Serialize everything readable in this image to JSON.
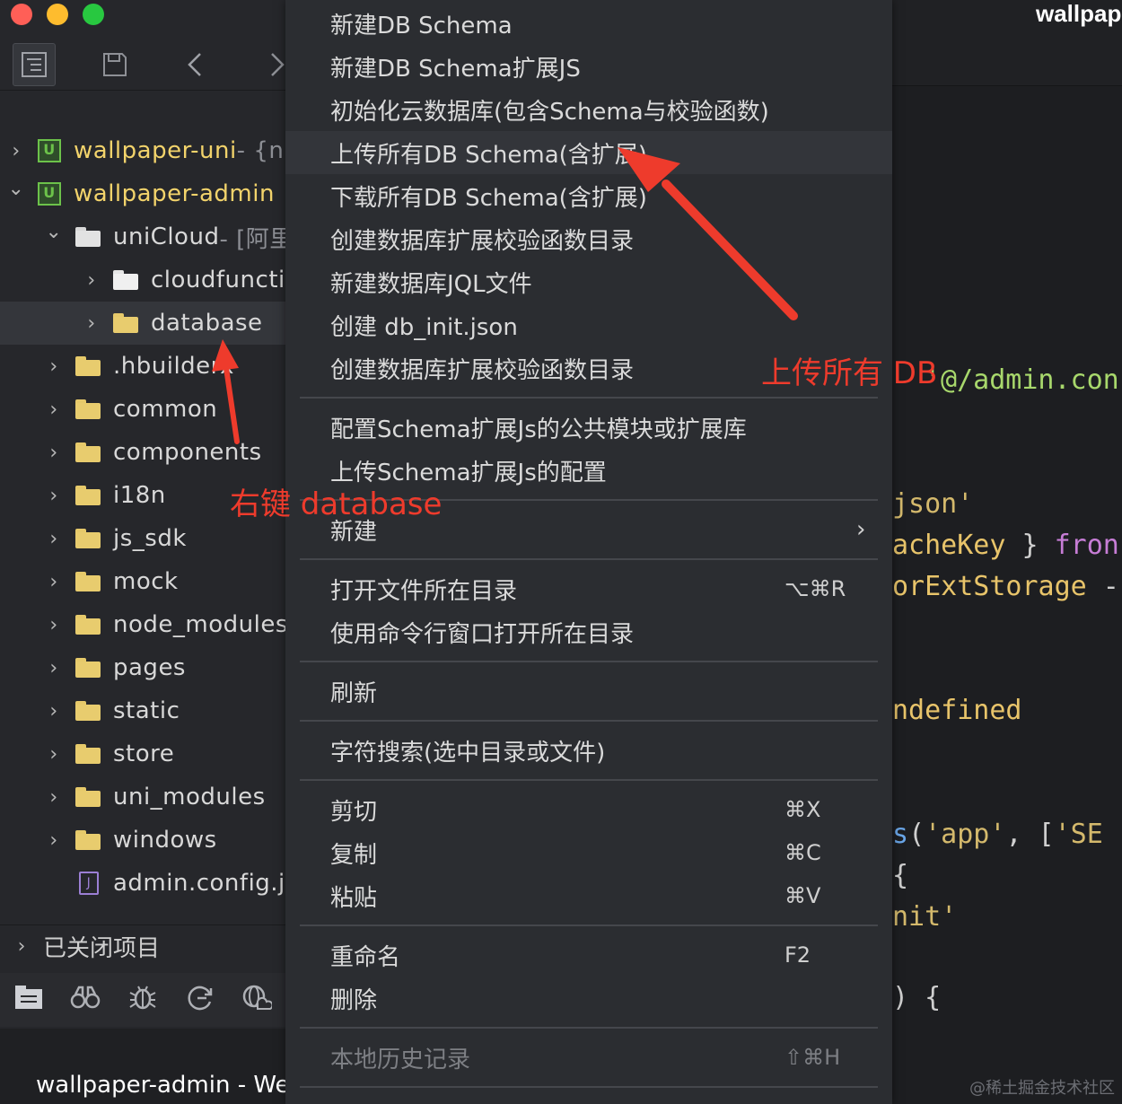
{
  "sidebar": {
    "toolbar": {
      "explorer_icon": "project-explorer-icon",
      "save_icon": "save-icon",
      "back_icon": "chevron-left-icon",
      "forward_icon": "chevron-right-icon"
    },
    "tree": [
      {
        "label": "wallpaper-uni",
        "suffix": " - {n",
        "expanded": false,
        "kind": "project"
      },
      {
        "label": "wallpaper-admin",
        "suffix": "",
        "expanded": true,
        "kind": "project"
      },
      {
        "label": "uniCloud",
        "suffix": " - [阿里",
        "expanded": true,
        "kind": "open-folder"
      },
      {
        "label": "cloudfunctio",
        "suffix": "",
        "expanded": false,
        "kind": "cloud-folder"
      },
      {
        "label": "database",
        "suffix": "",
        "expanded": false,
        "kind": "folder",
        "selected": true
      },
      {
        "label": ".hbuilderx",
        "suffix": "",
        "expanded": false,
        "kind": "folder"
      },
      {
        "label": "common",
        "suffix": "",
        "expanded": false,
        "kind": "folder"
      },
      {
        "label": "components",
        "suffix": "",
        "expanded": false,
        "kind": "folder"
      },
      {
        "label": "i18n",
        "suffix": "",
        "expanded": false,
        "kind": "folder"
      },
      {
        "label": "js_sdk",
        "suffix": "",
        "expanded": false,
        "kind": "folder"
      },
      {
        "label": "mock",
        "suffix": "",
        "expanded": false,
        "kind": "folder"
      },
      {
        "label": "node_modules",
        "suffix": "",
        "expanded": false,
        "kind": "folder"
      },
      {
        "label": "pages",
        "suffix": "",
        "expanded": false,
        "kind": "folder"
      },
      {
        "label": "static",
        "suffix": "",
        "expanded": false,
        "kind": "folder"
      },
      {
        "label": "store",
        "suffix": "",
        "expanded": false,
        "kind": "folder"
      },
      {
        "label": "uni_modules",
        "suffix": "",
        "expanded": false,
        "kind": "folder"
      },
      {
        "label": "windows",
        "suffix": "",
        "expanded": false,
        "kind": "folder"
      },
      {
        "label": "admin.config.js",
        "suffix": "",
        "expanded": false,
        "kind": "js-file"
      }
    ],
    "closed_projects": "已关闭项目",
    "bottom_tools": [
      "project-icon",
      "binoculars-icon",
      "bug-icon",
      "sync-icon",
      "cloud-globe-icon"
    ],
    "status_text": "wallpaper-admin - Web"
  },
  "menu": {
    "items": [
      {
        "label": "新建DB Schema",
        "shortcut": ""
      },
      {
        "label": "新建DB Schema扩展JS",
        "shortcut": ""
      },
      {
        "label": "初始化云数据库(包含Schema与校验函数)",
        "shortcut": ""
      },
      {
        "label": "上传所有DB Schema(含扩展)",
        "shortcut": "",
        "highlighted": true
      },
      {
        "label": "下载所有DB Schema(含扩展)",
        "shortcut": ""
      },
      {
        "label": "创建数据库扩展校验函数目录",
        "shortcut": ""
      },
      {
        "label": "新建数据库JQL文件",
        "shortcut": ""
      },
      {
        "label": "创建 db_init.json",
        "shortcut": ""
      },
      {
        "label": "创建数据库扩展校验函数目录",
        "shortcut": ""
      },
      {
        "label": "配置Schema扩展Js的公共模块或扩展库",
        "shortcut": ""
      },
      {
        "label": "上传Schema扩展Js的配置",
        "shortcut": ""
      },
      {
        "label": "新建",
        "shortcut": "",
        "submenu": true
      },
      {
        "label": "打开文件所在目录",
        "shortcut": "⌥⌘R"
      },
      {
        "label": "使用命令行窗口打开所在目录",
        "shortcut": ""
      },
      {
        "label": "刷新",
        "shortcut": ""
      },
      {
        "label": "字符搜索(选中目录或文件)",
        "shortcut": ""
      },
      {
        "label": "剪切",
        "shortcut": "⌘X"
      },
      {
        "label": "复制",
        "shortcut": "⌘C"
      },
      {
        "label": "粘贴",
        "shortcut": "⌘V"
      },
      {
        "label": "重命名",
        "shortcut": "F2"
      },
      {
        "label": "删除",
        "shortcut": ""
      },
      {
        "label": "本地历史记录",
        "shortcut": "⇧⌘H",
        "disabled": true
      }
    ],
    "submenu_arrow": "›"
  },
  "editor": {
    "title": "wallpap",
    "lines": [
      {
        "segments": [
          {
            "t": "'@/admin.con",
            "c": "c-grn"
          }
        ]
      },
      {
        "segments": [
          {
            "t": "json'",
            "c": "c-str"
          }
        ]
      },
      {
        "segments": [
          {
            "t": "acheKey",
            "c": "c-id"
          },
          {
            "t": " } ",
            "c": "c-pl"
          },
          {
            "t": "fron",
            "c": "c-kw"
          }
        ]
      },
      {
        "segments": [
          {
            "t": "orExtStorage",
            "c": "c-id"
          },
          {
            "t": " -",
            "c": "c-pl"
          }
        ]
      },
      {
        "segments": [
          {
            "t": "ndefined",
            "c": "c-id"
          }
        ]
      },
      {
        "segments": [
          {
            "t": "s",
            "c": "c-fn"
          },
          {
            "t": "(",
            "c": "c-pl"
          },
          {
            "t": "'app'",
            "c": "c-str"
          },
          {
            "t": ", [",
            "c": "c-pl"
          },
          {
            "t": "'SE",
            "c": "c-str"
          }
        ]
      },
      {
        "segments": [
          {
            "t": "{",
            "c": "c-pl"
          }
        ]
      },
      {
        "segments": [
          {
            "t": "nit'",
            "c": "c-str"
          }
        ]
      },
      {
        "segments": [
          {
            "t": ") {",
            "c": "c-pl"
          }
        ]
      }
    ],
    "watermark": "@稀土掘金技术社区"
  },
  "annotations": {
    "upload_note": "上传所有 DB",
    "right_click_note": "右键 database",
    "accent_color": "#ee3b2c"
  }
}
